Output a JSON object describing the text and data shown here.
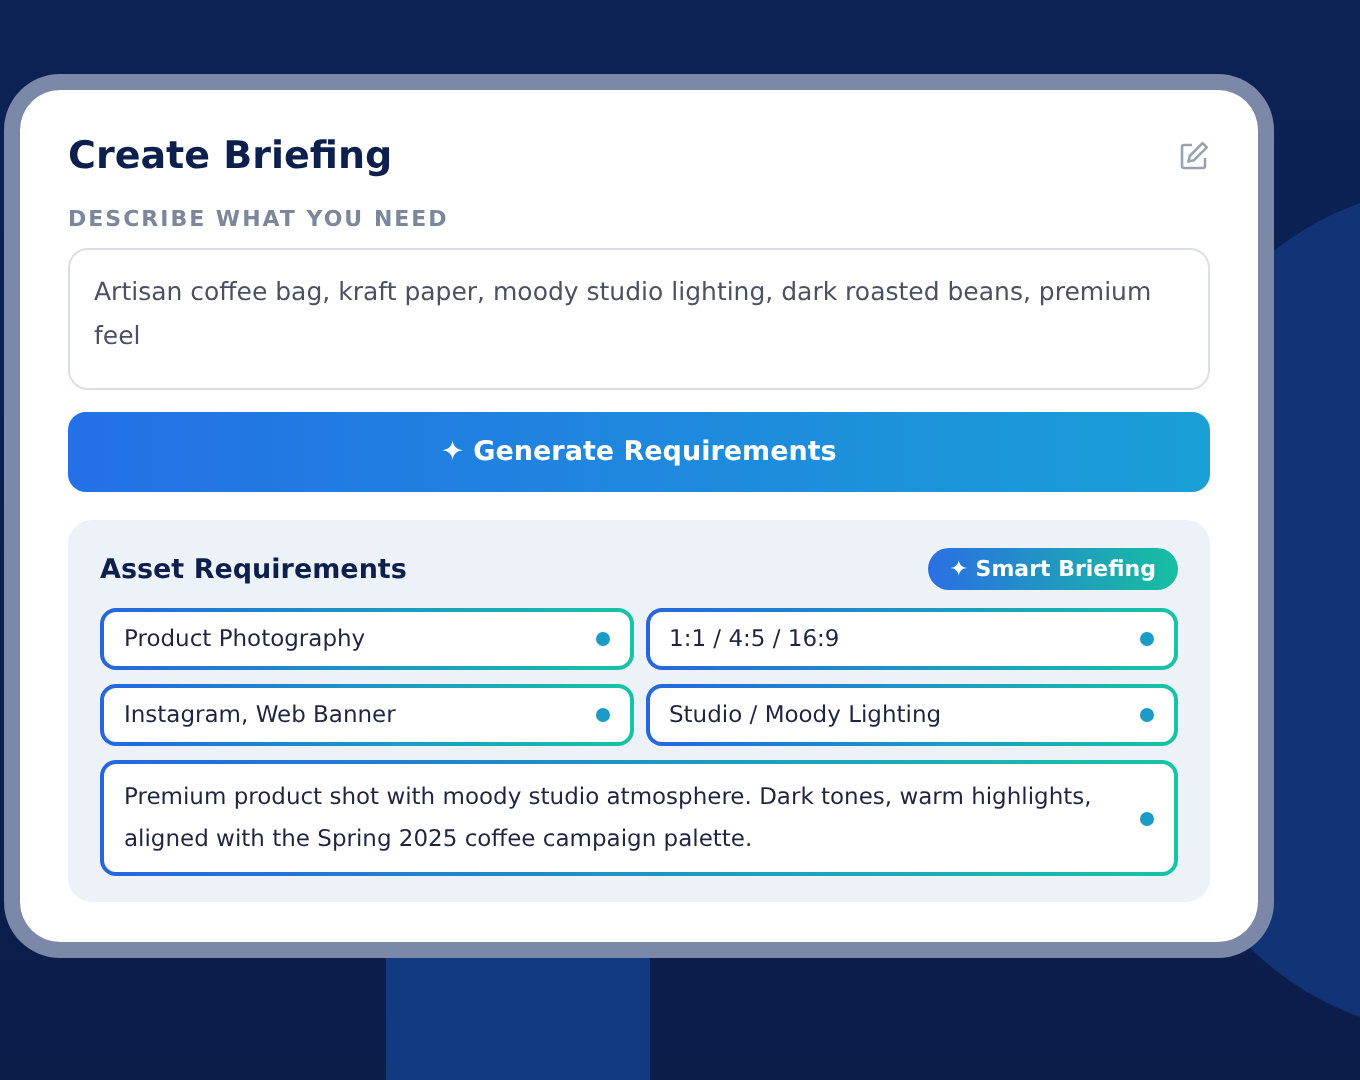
{
  "card": {
    "title": "Create Briefing",
    "field_label": "DESCRIBE WHAT YOU NEED",
    "description": {
      "value": "Artisan coffee bag, kraft paper, moody studio lighting, dark roasted beans, premium feel"
    },
    "generate_button": {
      "icon": "✦",
      "label": "Generate Requirements"
    },
    "requirements": {
      "title": "Asset Requirements",
      "badge": {
        "icon": "✦",
        "label": "Smart Briefing"
      },
      "fields": [
        {
          "value": "Product Photography",
          "kind": "short"
        },
        {
          "value": "1:1 / 4:5 / 16:9",
          "kind": "short"
        },
        {
          "value": "Instagram, Web Banner",
          "kind": "short"
        },
        {
          "value": "Studio / Moody Lighting",
          "kind": "short"
        },
        {
          "value": "Premium product shot with moody studio atmosphere. Dark tones, warm highlights, aligned with the Spring 2025 coffee campaign palette.",
          "kind": "wide"
        }
      ]
    }
  }
}
